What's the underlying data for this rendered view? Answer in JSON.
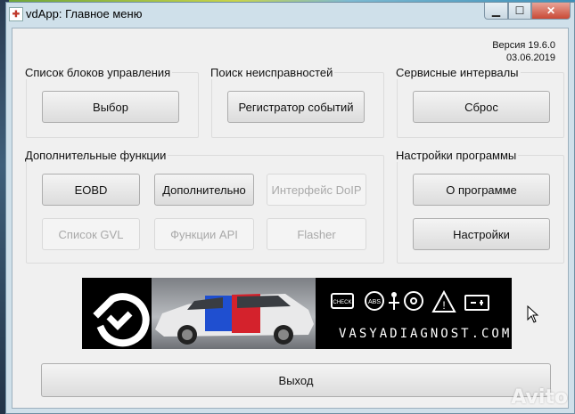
{
  "window": {
    "title": "vdApp:  Главное меню",
    "controls": {
      "minimize_icon": "minimize-icon",
      "maximize_icon": "maximize-icon",
      "close_icon": "close-icon"
    }
  },
  "version": {
    "label": "Версия 19.6.0",
    "date": "03.06.2019"
  },
  "groups": {
    "control_units": {
      "label": "Список блоков управления",
      "button": "Выбор"
    },
    "fault_search": {
      "label": "Поиск неисправностей",
      "button": "Регистратор событий"
    },
    "service": {
      "label": "Сервисные интервалы",
      "button": "Сброс"
    },
    "extra": {
      "label": "Дополнительные функции",
      "buttons": {
        "eobd": "EOBD",
        "additional": "Дополнительно",
        "doip": "Интерфейс DoIP",
        "gvl": "Список GVL",
        "api": "Функции API",
        "flasher": "Flasher"
      }
    },
    "settings": {
      "label": "Настройки программы",
      "about": "О программе",
      "settings": "Настройки"
    }
  },
  "banner": {
    "text": "VASYADIAGNOST.COM",
    "check_label": "CHECK",
    "abs_label": "ABS"
  },
  "exit_button": "Выход",
  "watermark": "Avito",
  "colors": {
    "stripe_blue": "#1f4fd0",
    "stripe_red": "#d4222c",
    "close": "#c94a36"
  }
}
